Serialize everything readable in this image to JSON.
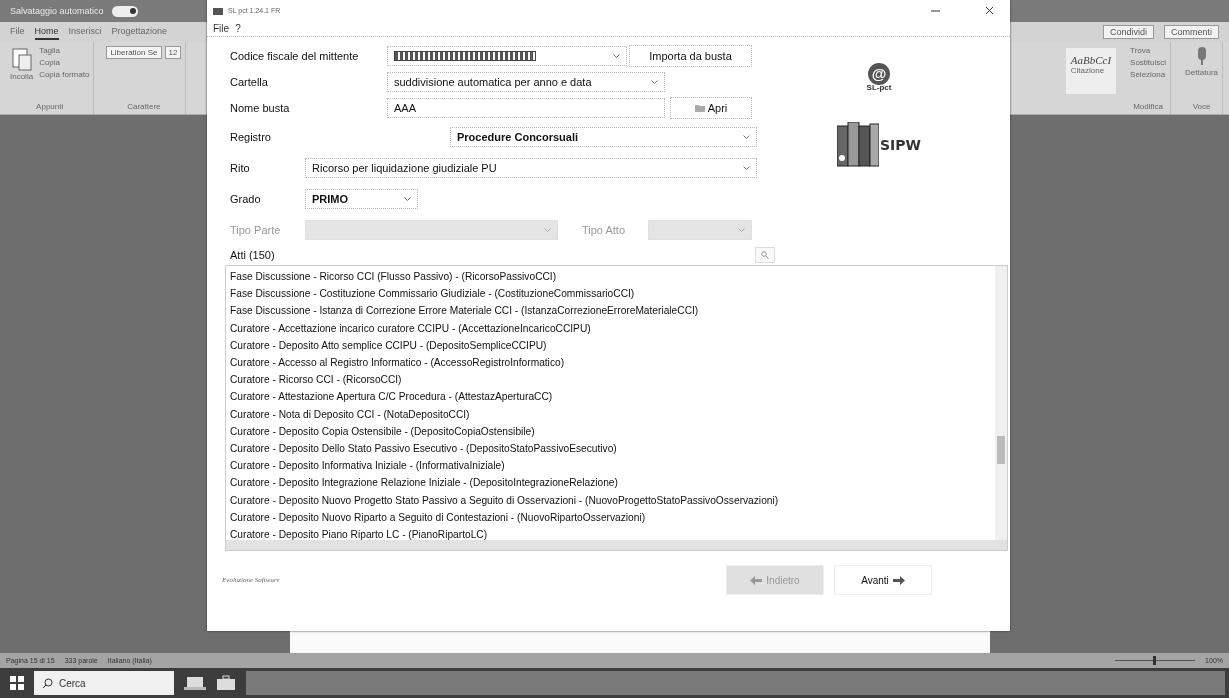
{
  "word": {
    "autosave_label": "Salvataggio automatico",
    "autosave_on": true,
    "zoom_slider": {
      "level": 0.5
    },
    "tabs": [
      {
        "label": "File",
        "selected": false
      },
      {
        "label": "Home",
        "selected": true
      },
      {
        "label": "Inserisci",
        "selected": false
      },
      {
        "label": "Progettazione",
        "selected": false
      }
    ],
    "clipboard": {
      "paste": "Incolla",
      "cut": "Taglia",
      "copy": "Copia",
      "format_painter": "Copia formato",
      "group": "Appunti"
    },
    "font": {
      "name": "Liberation Se",
      "size": "12",
      "group": "Carattere"
    },
    "styles": {
      "sample": "AaBbCcI",
      "name": "Citazione"
    },
    "editing": {
      "items": [
        "Trova",
        "Sostituisci",
        "Seleziona"
      ],
      "group": "Modifica"
    },
    "voice": {
      "label": "Dettatura",
      "group": "Voce"
    },
    "share": "Condividi",
    "comments": "Commenti",
    "status_bar": [
      "Pagina 15 di 15",
      "333 parole",
      "Italiano (Italia)"
    ],
    "zoom": "100%"
  },
  "taskbar": {
    "search_placeholder": "Cerca"
  },
  "dialog": {
    "title": "SL pct 1.24.1 FR",
    "menu": [
      "File",
      "?"
    ],
    "fields": {
      "codice_label": "Codice fiscale del mittente",
      "codice_redacted": true,
      "import_button": "Importa da busta",
      "cartella_label": "Cartella",
      "cartella_value": "suddivisione automatica per anno e data",
      "nome_label": "Nome busta",
      "nome_value": "AAA",
      "apri_button": "Apri",
      "registro_label": "Registro",
      "registro_value": "Procedure Concorsuali",
      "rito_label": "Rito",
      "rito_value": "Ricorso per liquidazione giudiziale PU",
      "grado_label": "Grado",
      "grado_value": "PRIMO",
      "tipo_parte_label": "Tipo Parte",
      "tipo_parte_disabled": true,
      "tipo_atto_label": "Tipo Atto",
      "tipo_atto_disabled": true
    },
    "logo_symbol": "@",
    "logo_caption": "SL-pct",
    "books_caption": "SIPW",
    "atti_label": "Atti (150)",
    "atti": [
      "Fase Discussione - Ricorso CCI (Flusso Passivo) - (RicorsoPassivoCCI)",
      "Fase Discussione - Costituzione Commissario Giudiziale - (CostituzioneCommissarioCCI)",
      "Fase Discussione - Istanza di Correzione Errore Materiale CCI - (IstanzaCorrezioneErroreMaterialeCCI)",
      "Curatore - Accettazione incarico curatore CCIPU - (AccettazioneIncaricoCCIPU)",
      "Curatore - Deposito Atto semplice CCIPU - (DepositoSempliceCCIPU)",
      "Curatore - Accesso al Registro Informatico - (AccessoRegistroInformatico)",
      "Curatore - Ricorso CCI - (RicorsoCCI)",
      "Curatore - Attestazione Apertura C/C Procedura - (AttestazAperturaCC)",
      "Curatore - Nota di Deposito CCI - (NotaDepositoCCI)",
      "Curatore - Deposito Copia Ostensibile - (DepositoCopiaOstensibile)",
      "Curatore - Deposito Dello Stato Passivo Esecutivo - (DepositoStatoPassivoEsecutivo)",
      "Curatore - Deposito Informativa Iniziale - (InformativaIniziale)",
      "Curatore - Deposito Integrazione Relazione Iniziale - (DepositoIntegrazioneRelazione)",
      "Curatore - Deposito Nuovo Progetto Stato Passivo a Seguito di Osservazioni - (NuovoProgettoStatoPassivoOsservazioni)",
      "Curatore - Deposito Nuovo Riparto a Seguito di Contestazioni - (NuovoRipartoOsservazioni)",
      "Curatore - Deposito Piano Riparto LC - (PianoRipartoLC)"
    ],
    "footer": "Evoluzione Software",
    "buttons": [
      {
        "label": "Indietro",
        "kind": "back",
        "disabled": true
      },
      {
        "label": "Avanti",
        "kind": "next",
        "disabled": false
      }
    ]
  }
}
